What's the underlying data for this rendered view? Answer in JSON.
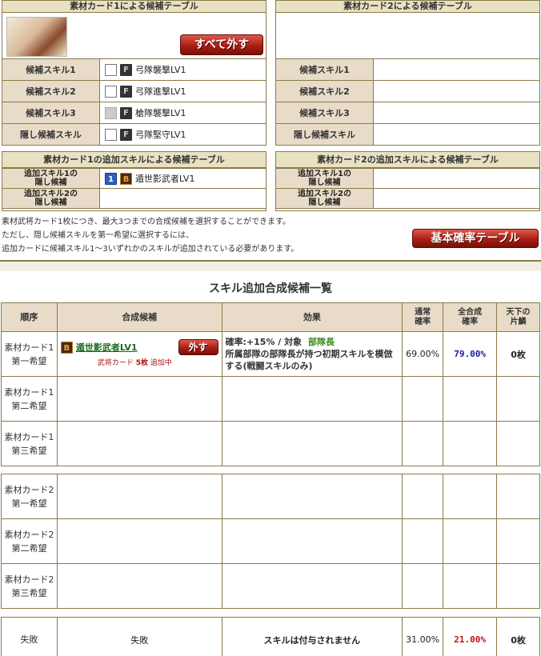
{
  "panel1": {
    "title": "素材カード1による候補テーブル",
    "remove_all_label": "すべて外す",
    "rows": [
      {
        "label": "候補スキル1",
        "rank": "F",
        "skill": "弓隊襲撃LV1",
        "disabled": false
      },
      {
        "label": "候補スキル2",
        "rank": "F",
        "skill": "弓隊進撃LV1",
        "disabled": false
      },
      {
        "label": "候補スキル3",
        "rank": "F",
        "skill": "槍隊襲撃LV1",
        "disabled": true
      },
      {
        "label": "隠し候補スキル",
        "rank": "F",
        "skill": "弓隊堅守LV1",
        "disabled": false
      }
    ]
  },
  "panel2": {
    "title": "素材カード2による候補テーブル",
    "rows": [
      {
        "label": "候補スキル1"
      },
      {
        "label": "候補スキル2"
      },
      {
        "label": "候補スキル3"
      },
      {
        "label": "隠し候補スキル"
      }
    ]
  },
  "add1": {
    "title": "素材カード1の追加スキルによる候補テーブル",
    "row1_label": "追加スキル1の\n隠し候補",
    "row1_num": "1",
    "row1_rank": "B",
    "row1_skill": "遁世影武者LV1",
    "row2_label": "追加スキル2の\n隠し候補"
  },
  "add2": {
    "title": "素材カード2の追加スキルによる候補テーブル",
    "row1_label": "追加スキル1の\n隠し候補",
    "row2_label": "追加スキル2の\n隠し候補"
  },
  "notes": [
    "素材武将カード1枚につき、最大3つまでの合成候補を選択することができます。",
    "ただし、隠し候補スキルを第一希望に選択するには、",
    "追加カードに候補スキル1〜3いずれかのスキルが追加されている必要があります。"
  ],
  "base_rate_button": "基本確率テーブル",
  "list_title": "スキル追加合成候補一覧",
  "headers": {
    "order": "順序",
    "candidate": "合成候補",
    "effect": "効果",
    "normal_rate": "通常\n確率",
    "total_rate": "全合成\n確率",
    "tenka": "天下の\n片鱗"
  },
  "candidates": [
    {
      "order": "素材カード1\n第一希望",
      "rank": "B",
      "skill": "遁世影武者LV1",
      "remove_label": "外す",
      "sub_prefix": "武将カード",
      "sub_count": "5枚",
      "sub_suffix": "追加中",
      "effect_rate": "確率:+15% / 対象",
      "effect_target": "部隊長",
      "effect_desc": "所属部隊の部隊長が持つ初期スキルを模倣する(戦闘スキルのみ)",
      "normal_rate": "69.00%",
      "total_rate": "79.00%",
      "tenka": "0枚"
    },
    {
      "order": "素材カード1\n第二希望"
    },
    {
      "order": "素材カード1\n第三希望"
    }
  ],
  "candidates2": [
    {
      "order": "素材カード2\n第一希望"
    },
    {
      "order": "素材カード2\n第二希望"
    },
    {
      "order": "素材カード2\n第三希望"
    }
  ],
  "fail": {
    "order": "失敗",
    "candidate": "失敗",
    "effect": "スキルは付与されません",
    "normal_rate": "31.00%",
    "total_rate": "21.00%",
    "tenka": "0枚"
  }
}
